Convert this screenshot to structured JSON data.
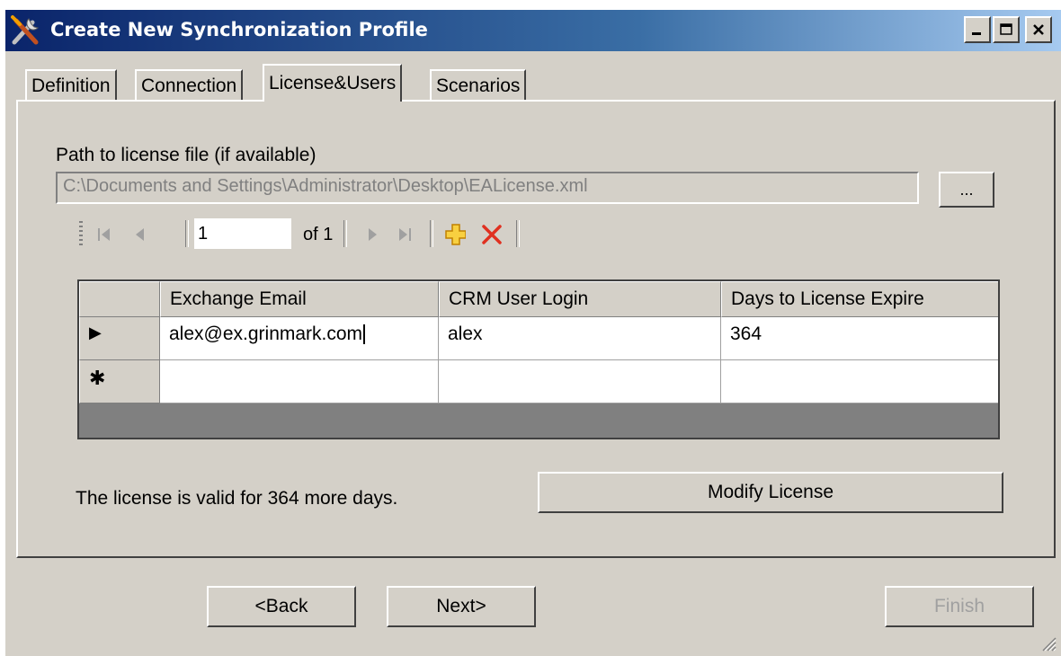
{
  "window": {
    "title": "Create New Synchronization Profile"
  },
  "tabs": [
    {
      "label": "Definition"
    },
    {
      "label": "Connection"
    },
    {
      "label": "License&Users"
    },
    {
      "label": "Scenarios"
    }
  ],
  "license": {
    "path_label": "Path to license file (if available)",
    "path_value": "C:\\Documents and Settings\\Administrator\\Desktop\\EALicense.xml",
    "browse_label": "...",
    "status_text": "The license is valid for 364 more days.",
    "modify_label": "Modify License"
  },
  "navigator": {
    "position": "1",
    "count_label": "of 1",
    "icons": [
      "move-first-icon",
      "move-previous-icon",
      "move-next-icon",
      "move-last-icon",
      "add-icon",
      "delete-icon"
    ],
    "colors": {
      "add": "#f0b400",
      "delete": "#e03020"
    }
  },
  "grid": {
    "columns": [
      "Exchange Email",
      "CRM User Login",
      "Days to License Expire"
    ],
    "rows": [
      {
        "indicator": "▶",
        "cells": [
          "alex@ex.grinmark.com",
          "alex",
          "364"
        ]
      },
      {
        "indicator": "✱",
        "cells": [
          "",
          "",
          ""
        ]
      }
    ]
  },
  "footer": {
    "back_label": "<Back",
    "next_label": "Next>",
    "finish_label": "Finish"
  }
}
